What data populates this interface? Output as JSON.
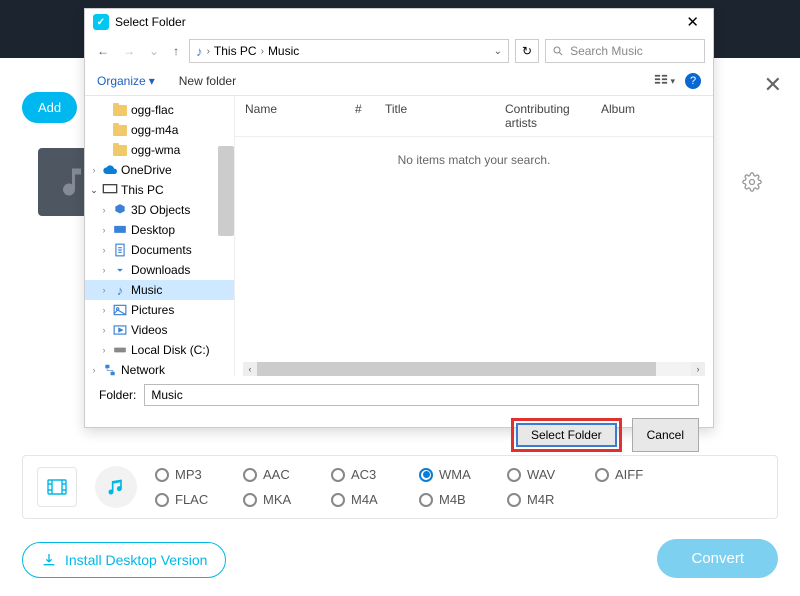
{
  "dialog": {
    "title": "Select Folder",
    "breadcrumb": {
      "root": "This PC",
      "current": "Music"
    },
    "search_placeholder": "Search Music",
    "toolbar": {
      "organize": "Organize",
      "newfolder": "New folder"
    },
    "tree": {
      "items": [
        {
          "label": "ogg-flac",
          "icon": "folder",
          "indent": 2,
          "caret": ""
        },
        {
          "label": "ogg-m4a",
          "icon": "folder",
          "indent": 2,
          "caret": ""
        },
        {
          "label": "ogg-wma",
          "icon": "folder",
          "indent": 2,
          "caret": ""
        },
        {
          "label": "OneDrive",
          "icon": "onedrive",
          "indent": 1,
          "caret": ">"
        },
        {
          "label": "This PC",
          "icon": "pc",
          "indent": 1,
          "caret": "v"
        },
        {
          "label": "3D Objects",
          "icon": "3d",
          "indent": 2,
          "caret": ">"
        },
        {
          "label": "Desktop",
          "icon": "desktop",
          "indent": 2,
          "caret": ">"
        },
        {
          "label": "Documents",
          "icon": "docs",
          "indent": 2,
          "caret": ">"
        },
        {
          "label": "Downloads",
          "icon": "downloads",
          "indent": 2,
          "caret": ">"
        },
        {
          "label": "Music",
          "icon": "music",
          "indent": 2,
          "caret": ">",
          "selected": true
        },
        {
          "label": "Pictures",
          "icon": "pictures",
          "indent": 2,
          "caret": ">"
        },
        {
          "label": "Videos",
          "icon": "videos",
          "indent": 2,
          "caret": ">"
        },
        {
          "label": "Local Disk (C:)",
          "icon": "disk",
          "indent": 2,
          "caret": ">"
        },
        {
          "label": "Network",
          "icon": "network",
          "indent": 1,
          "caret": ">"
        }
      ]
    },
    "columns": {
      "name": "Name",
      "num": "#",
      "title": "Title",
      "contrib": "Contributing artists",
      "album": "Album"
    },
    "empty": "No items match your search.",
    "folder_label": "Folder:",
    "folder_value": "Music",
    "select_btn": "Select Folder",
    "cancel_btn": "Cancel"
  },
  "bg": {
    "add": "Add",
    "formats": [
      "MP3",
      "AAC",
      "AC3",
      "WMA",
      "WAV",
      "AIFF",
      "FLAC",
      "MKA",
      "M4A",
      "M4B",
      "M4R"
    ],
    "selected_format": "WMA",
    "install": "Install Desktop Version",
    "convert": "Convert"
  }
}
